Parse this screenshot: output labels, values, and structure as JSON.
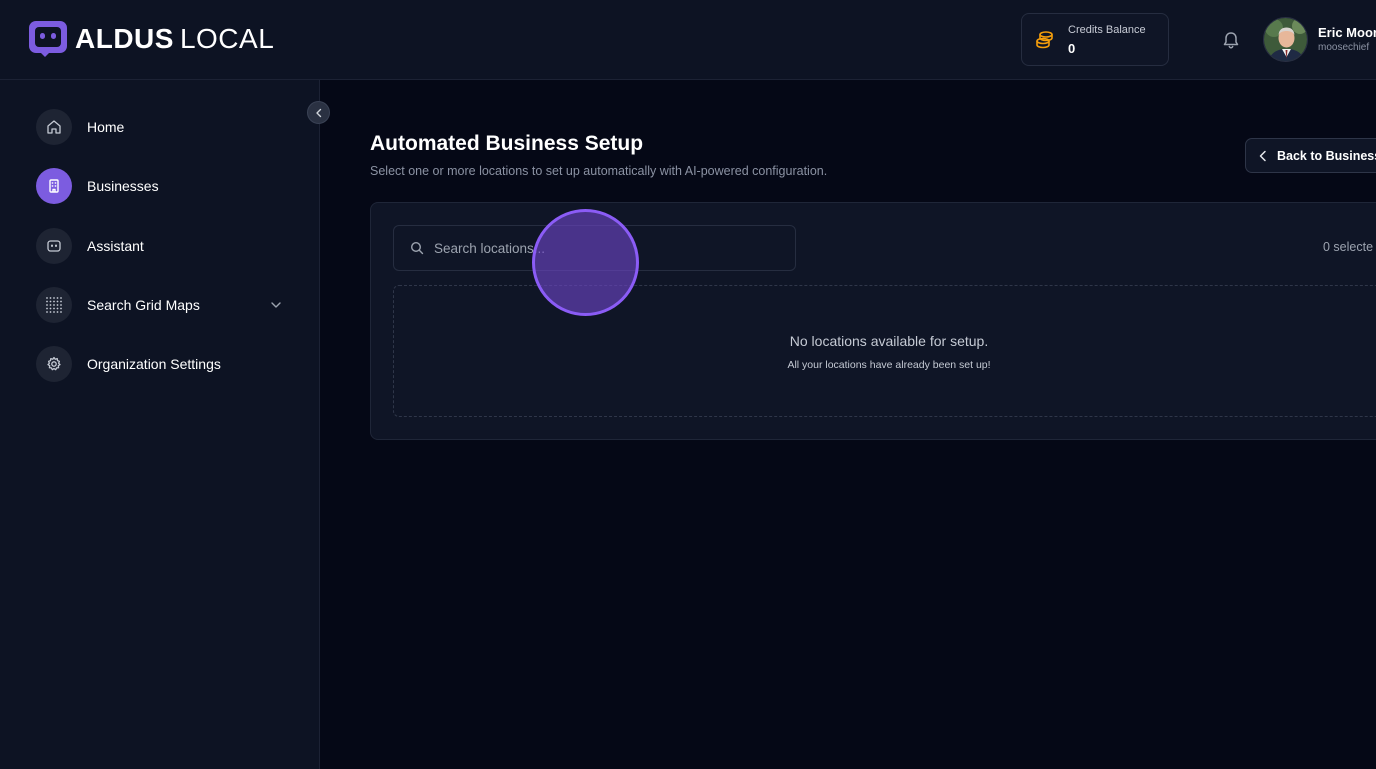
{
  "header": {
    "logo": {
      "word_bold": "ALDUS",
      "word_light": "LOCAL",
      "icon": "robot-face-logo"
    },
    "credits": {
      "label": "Credits Balance",
      "value": "0",
      "icon": "coins-icon"
    },
    "notifications_icon": "bell-icon",
    "user": {
      "name": "Eric Moor",
      "handle": "moosechief"
    }
  },
  "sidebar": {
    "collapse_icon": "chevron-left-icon",
    "items": [
      {
        "label": "Home",
        "icon": "home-icon",
        "active": false
      },
      {
        "label": "Businesses",
        "icon": "building-icon",
        "active": true
      },
      {
        "label": "Assistant",
        "icon": "robot-icon",
        "active": false
      },
      {
        "label": "Search Grid Maps",
        "icon": "grid-icon",
        "active": false,
        "expandable": true
      },
      {
        "label": "Organization Settings",
        "icon": "gear-icon",
        "active": false
      }
    ]
  },
  "main": {
    "title": "Automated Business Setup",
    "subtitle": "Select one or more locations to set up automatically with AI-powered configuration.",
    "back_button": "Back to Business",
    "search": {
      "placeholder": "Search locations...",
      "value": ""
    },
    "selected_count": "0 selecte",
    "empty_state": {
      "title": "No locations available for setup.",
      "subtitle": "All your locations have already been set up!"
    }
  },
  "colors": {
    "accent": "#7c5ce0",
    "background": "#050816",
    "panel": "#0d1323",
    "credits_icon": "#f59e0b"
  }
}
